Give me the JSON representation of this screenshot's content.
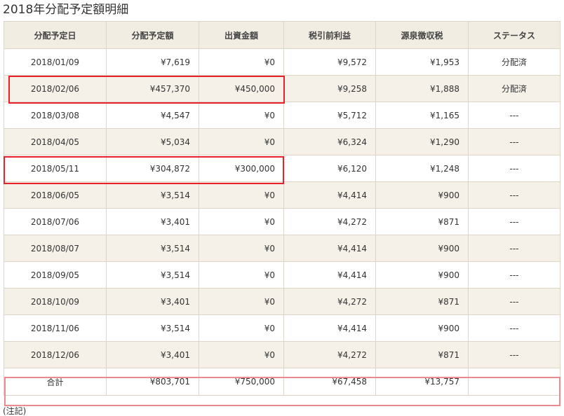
{
  "page": {
    "title": "2018年分配予定額明細"
  },
  "table": {
    "headers": [
      "分配予定日",
      "分配予定額",
      "出資金額",
      "税引前利益",
      "源泉徴収税",
      "ステータス"
    ],
    "rows": [
      {
        "date": "2018/01/09",
        "amount": "¥7,619",
        "investment": "¥0",
        "pretax": "¥9,572",
        "tax": "¥1,953",
        "status": "分配済"
      },
      {
        "date": "2018/02/06",
        "amount": "¥457,370",
        "investment": "¥450,000",
        "pretax": "¥9,258",
        "tax": "¥1,888",
        "status": "分配済"
      },
      {
        "date": "2018/03/08",
        "amount": "¥4,547",
        "investment": "¥0",
        "pretax": "¥5,712",
        "tax": "¥1,165",
        "status": "---"
      },
      {
        "date": "2018/04/05",
        "amount": "¥5,034",
        "investment": "¥0",
        "pretax": "¥6,324",
        "tax": "¥1,290",
        "status": "---"
      },
      {
        "date": "2018/05/11",
        "amount": "¥304,872",
        "investment": "¥300,000",
        "pretax": "¥6,120",
        "tax": "¥1,248",
        "status": "---"
      },
      {
        "date": "2018/06/05",
        "amount": "¥3,514",
        "investment": "¥0",
        "pretax": "¥4,414",
        "tax": "¥900",
        "status": "---"
      },
      {
        "date": "2018/07/06",
        "amount": "¥3,401",
        "investment": "¥0",
        "pretax": "¥4,272",
        "tax": "¥871",
        "status": "---"
      },
      {
        "date": "2018/08/07",
        "amount": "¥3,514",
        "investment": "¥0",
        "pretax": "¥4,414",
        "tax": "¥900",
        "status": "---"
      },
      {
        "date": "2018/09/05",
        "amount": "¥3,514",
        "investment": "¥0",
        "pretax": "¥4,414",
        "tax": "¥900",
        "status": "---"
      },
      {
        "date": "2018/10/09",
        "amount": "¥3,401",
        "investment": "¥0",
        "pretax": "¥4,272",
        "tax": "¥871",
        "status": "---"
      },
      {
        "date": "2018/11/06",
        "amount": "¥3,514",
        "investment": "¥0",
        "pretax": "¥4,414",
        "tax": "¥900",
        "status": "---"
      },
      {
        "date": "2018/12/06",
        "amount": "¥3,401",
        "investment": "¥0",
        "pretax": "¥4,272",
        "tax": "¥871",
        "status": "---"
      }
    ],
    "total": {
      "label": "合計",
      "amount": "¥803,701",
      "investment": "¥750,000",
      "pretax": "¥67,458",
      "tax": "¥13,757",
      "status": ""
    }
  },
  "highlight_colors": {
    "row": "#e8202a",
    "total": "#ec8a90"
  },
  "note": "(注記)"
}
